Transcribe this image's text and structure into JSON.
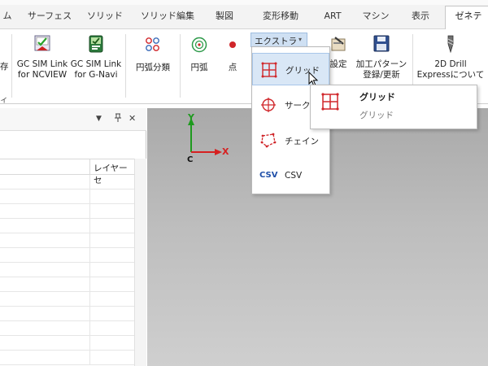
{
  "tabs": [
    {
      "label": "ム"
    },
    {
      "label": "サーフェス"
    },
    {
      "label": "ソリッド"
    },
    {
      "label": "ソリッド編集"
    },
    {
      "label": "製図"
    },
    {
      "label": "変形移動"
    },
    {
      "label": "ART"
    },
    {
      "label": "マシン"
    },
    {
      "label": "表示"
    },
    {
      "label": "ゼネテ"
    }
  ],
  "ribbon": {
    "save_partial": "存",
    "gc_ncview": {
      "line1": "GC SIM Link",
      "line2": "for NCVIEW"
    },
    "gc_gnavi": {
      "line1": "GC SIM Link",
      "line2": "for G-Navi"
    },
    "arc_classify": "円弧分類",
    "arc": "円弧",
    "point": "点",
    "extra_dropdown": "エクストラ",
    "settings_partial": "設定",
    "pattern_register": {
      "line1": "加工パターン",
      "line2": "登録/更新"
    },
    "drill_express": {
      "line1": "2D Drill",
      "line2": "Expressについて"
    },
    "group_label_partial": "ィ"
  },
  "dropdown": {
    "items": [
      {
        "label": "グリッド",
        "icon": "grid-icon"
      },
      {
        "label": "サーク",
        "icon": "circle-icon"
      },
      {
        "label": "チェイン",
        "icon": "chain-icon"
      },
      {
        "label": "CSV",
        "icon_text": "CSV"
      }
    ]
  },
  "tooltip": {
    "title": "グリッド",
    "description": "グリッド"
  },
  "panel": {
    "pin_glyph": "ㅋ",
    "close_glyph": "✕",
    "column_header": "レイヤーセ"
  },
  "viewport": {
    "axis_y": "Y",
    "axis_x": "X",
    "axis_origin": "C"
  },
  "colors": {
    "axis_x": "#d62020",
    "axis_y": "#1e9a1e",
    "icon_red": "#d0262a",
    "highlight": "#d9e7f6",
    "csv_blue": "#1f4fa8"
  }
}
